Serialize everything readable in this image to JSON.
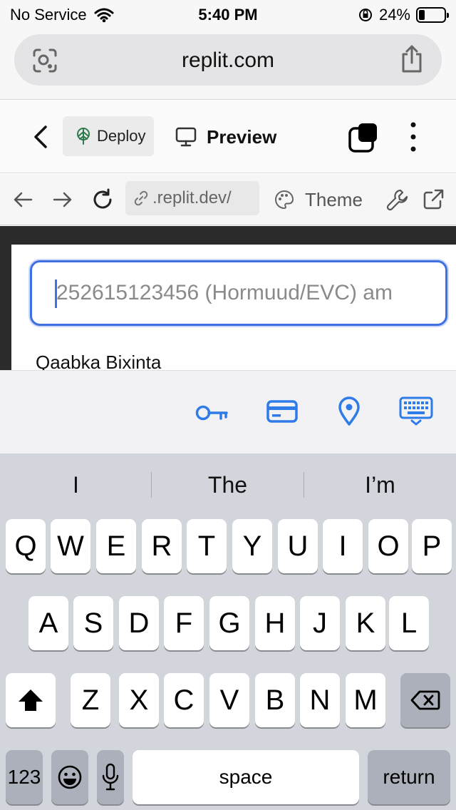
{
  "status_bar": {
    "carrier": "No Service",
    "time": "5:40 PM",
    "battery_percent": "24%",
    "battery_level": 0.24
  },
  "browser": {
    "url": "replit.com"
  },
  "replit_toolbar": {
    "deploy_label": "Deploy",
    "preview_label": "Preview"
  },
  "preview_nav": {
    "url": ".replit.dev/",
    "theme_label": "Theme"
  },
  "page": {
    "phone_input_placeholder": "252615123456 (Hormuud/EVC) am",
    "section_label": "Qaabka Bixinta"
  },
  "keyboard": {
    "suggestions": [
      "I",
      "The",
      "I’m"
    ],
    "row1": [
      "Q",
      "W",
      "E",
      "R",
      "T",
      "Y",
      "U",
      "I",
      "O",
      "P"
    ],
    "row2": [
      "A",
      "S",
      "D",
      "F",
      "G",
      "H",
      "J",
      "K",
      "L"
    ],
    "row3": [
      "Z",
      "X",
      "C",
      "V",
      "B",
      "N",
      "M"
    ],
    "numbers_label": "123",
    "space_label": "space",
    "return_label": "return"
  },
  "colors": {
    "accent": "#3f6fe0",
    "autofill_icon": "#2f7be8",
    "keyboard_bg": "#d2d5db"
  }
}
